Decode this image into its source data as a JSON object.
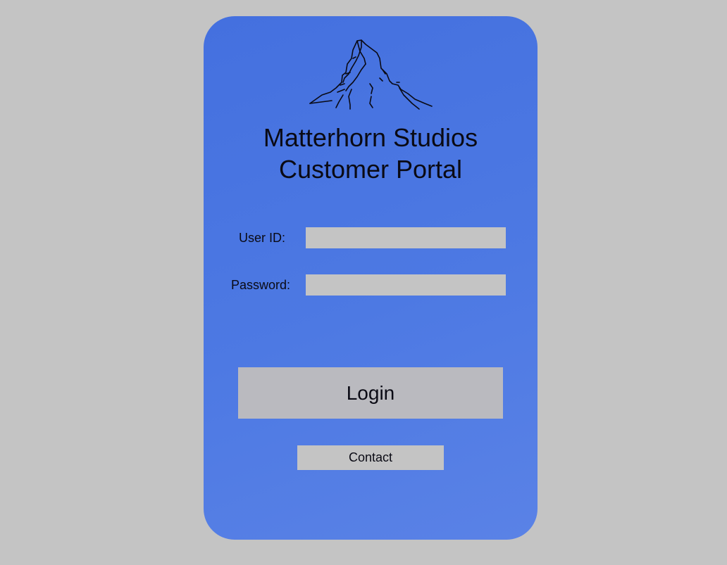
{
  "header": {
    "logo_icon": "mountain-icon",
    "title_line1": "Matterhorn Studios",
    "title_line2": "Customer Portal"
  },
  "form": {
    "user_id_label": "User ID:",
    "user_id_value": "",
    "password_label": "Password:",
    "password_value": ""
  },
  "actions": {
    "login_label": "Login",
    "contact_label": "Contact"
  },
  "colors": {
    "page_background": "#c4c4c4",
    "card_background": "#4a75e1",
    "input_background": "#c4c4c4",
    "login_button": "#bababf",
    "text": "#0a0a14"
  }
}
